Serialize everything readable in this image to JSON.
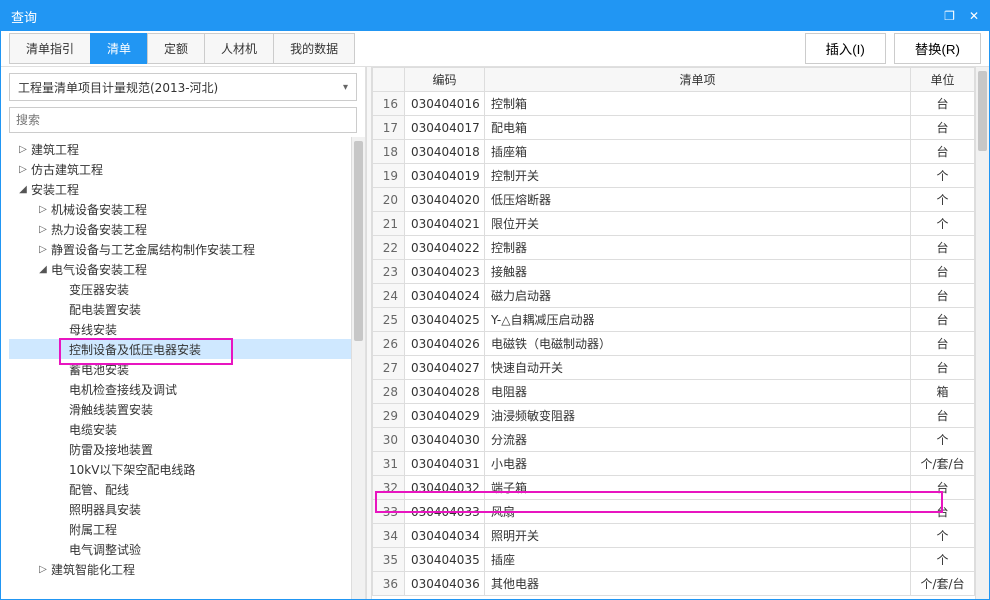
{
  "window": {
    "title": "查询"
  },
  "tabs": [
    "清单指引",
    "清单",
    "定额",
    "人材机",
    "我的数据"
  ],
  "activeTabIndex": 1,
  "actions": {
    "insert": "插入(I)",
    "replace": "替换(R)"
  },
  "dropdown": {
    "selected": "工程量清单项目计量规范(2013-河北)"
  },
  "search": {
    "placeholder": "搜索"
  },
  "tree": [
    {
      "label": "建筑工程",
      "level": 1,
      "toggle": "closed"
    },
    {
      "label": "仿古建筑工程",
      "level": 1,
      "toggle": "closed"
    },
    {
      "label": "安装工程",
      "level": 1,
      "toggle": "open"
    },
    {
      "label": "机械设备安装工程",
      "level": 2,
      "toggle": "closed"
    },
    {
      "label": "热力设备安装工程",
      "level": 2,
      "toggle": "closed"
    },
    {
      "label": "静置设备与工艺金属结构制作安装工程",
      "level": 2,
      "toggle": "closed"
    },
    {
      "label": "电气设备安装工程",
      "level": 2,
      "toggle": "open"
    },
    {
      "label": "变压器安装",
      "level": 3,
      "toggle": "none"
    },
    {
      "label": "配电装置安装",
      "level": 3,
      "toggle": "none"
    },
    {
      "label": "母线安装",
      "level": 3,
      "toggle": "none"
    },
    {
      "label": "控制设备及低压电器安装",
      "level": 3,
      "toggle": "none",
      "selected": true
    },
    {
      "label": "蓄电池安装",
      "level": 3,
      "toggle": "none"
    },
    {
      "label": "电机检查接线及调试",
      "level": 3,
      "toggle": "none"
    },
    {
      "label": "滑触线装置安装",
      "level": 3,
      "toggle": "none"
    },
    {
      "label": "电缆安装",
      "level": 3,
      "toggle": "none"
    },
    {
      "label": "防雷及接地装置",
      "level": 3,
      "toggle": "none"
    },
    {
      "label": "10kV以下架空配电线路",
      "level": 3,
      "toggle": "none"
    },
    {
      "label": "配管、配线",
      "level": 3,
      "toggle": "none"
    },
    {
      "label": "照明器具安装",
      "level": 3,
      "toggle": "none"
    },
    {
      "label": "附属工程",
      "level": 3,
      "toggle": "none"
    },
    {
      "label": "电气调整试验",
      "level": 3,
      "toggle": "none"
    },
    {
      "label": "建筑智能化工程",
      "level": 2,
      "toggle": "closed"
    }
  ],
  "table": {
    "columns": {
      "rownum": "",
      "code": "编码",
      "desc": "清单项",
      "unit": "单位"
    },
    "rows": [
      {
        "n": "16",
        "code": "030404016",
        "desc": "控制箱",
        "unit": "台"
      },
      {
        "n": "17",
        "code": "030404017",
        "desc": "配电箱",
        "unit": "台"
      },
      {
        "n": "18",
        "code": "030404018",
        "desc": "插座箱",
        "unit": "台"
      },
      {
        "n": "19",
        "code": "030404019",
        "desc": "控制开关",
        "unit": "个"
      },
      {
        "n": "20",
        "code": "030404020",
        "desc": "低压熔断器",
        "unit": "个"
      },
      {
        "n": "21",
        "code": "030404021",
        "desc": "限位开关",
        "unit": "个"
      },
      {
        "n": "22",
        "code": "030404022",
        "desc": "控制器",
        "unit": "台"
      },
      {
        "n": "23",
        "code": "030404023",
        "desc": "接触器",
        "unit": "台"
      },
      {
        "n": "24",
        "code": "030404024",
        "desc": "磁力启动器",
        "unit": "台"
      },
      {
        "n": "25",
        "code": "030404025",
        "desc": "Y-△自耦减压启动器",
        "unit": "台"
      },
      {
        "n": "26",
        "code": "030404026",
        "desc": "电磁铁（电磁制动器）",
        "unit": "台"
      },
      {
        "n": "27",
        "code": "030404027",
        "desc": "快速自动开关",
        "unit": "台"
      },
      {
        "n": "28",
        "code": "030404028",
        "desc": "电阻器",
        "unit": "箱"
      },
      {
        "n": "29",
        "code": "030404029",
        "desc": "油浸频敏变阻器",
        "unit": "台"
      },
      {
        "n": "30",
        "code": "030404030",
        "desc": "分流器",
        "unit": "个"
      },
      {
        "n": "31",
        "code": "030404031",
        "desc": "小电器",
        "unit": "个/套/台"
      },
      {
        "n": "32",
        "code": "030404032",
        "desc": "端子箱",
        "unit": "台"
      },
      {
        "n": "33",
        "code": "030404033",
        "desc": "风扇",
        "unit": "台"
      },
      {
        "n": "34",
        "code": "030404034",
        "desc": "照明开关",
        "unit": "个"
      },
      {
        "n": "35",
        "code": "030404035",
        "desc": "插座",
        "unit": "个"
      },
      {
        "n": "36",
        "code": "030404036",
        "desc": "其他电器",
        "unit": "个/套/台"
      }
    ]
  }
}
